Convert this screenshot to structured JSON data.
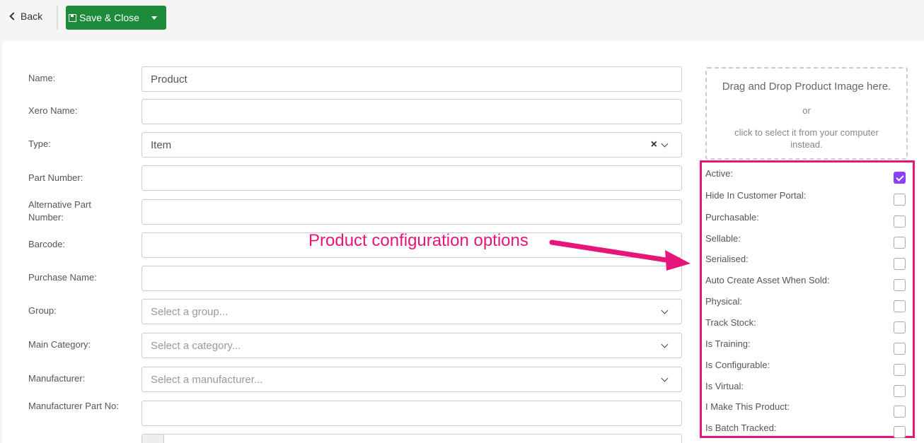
{
  "toolbar": {
    "back_label": "Back",
    "save_label": "Save & Close"
  },
  "form": {
    "name_label": "Name:",
    "name_value": "Product",
    "xero_label": "Xero Name:",
    "xero_value": "",
    "type_label": "Type:",
    "type_value": "Item",
    "part_label": "Part Number:",
    "part_value": "",
    "alt_part_label": "Alternative Part Number:",
    "alt_part_value": "",
    "barcode_label": "Barcode:",
    "barcode_value": "",
    "purchase_label": "Purchase Name:",
    "purchase_value": "",
    "group_label": "Group:",
    "group_placeholder": "Select a group...",
    "category_label": "Main Category:",
    "category_placeholder": "Select a category...",
    "manufacturer_label": "Manufacturer:",
    "manufacturer_placeholder": "Select a manufacturer...",
    "mpn_label": "Manufacturer Part No:",
    "mpn_value": ""
  },
  "image_drop": {
    "title": "Drag and Drop Product Image here.",
    "or": "or",
    "sub": "click to select it from your computer instead."
  },
  "options": [
    {
      "label": "Active:",
      "checked": true
    },
    {
      "label": "Hide In Customer Portal:",
      "checked": false
    },
    {
      "label": "Purchasable:",
      "checked": false
    },
    {
      "label": "Sellable:",
      "checked": false
    },
    {
      "label": "Serialised:",
      "checked": false
    },
    {
      "label": "Auto Create Asset When Sold:",
      "checked": false
    },
    {
      "label": "Physical:",
      "checked": false
    },
    {
      "label": "Track Stock:",
      "checked": false
    },
    {
      "label": "Is Training:",
      "checked": false
    },
    {
      "label": "Is Configurable:",
      "checked": false
    },
    {
      "label": "Is Virtual:",
      "checked": false
    },
    {
      "label": "I Make This Product:",
      "checked": false
    },
    {
      "label": "Is Batch Tracked:",
      "checked": false
    }
  ],
  "annotation": {
    "text": "Product configuration options",
    "color": "#e6157a"
  },
  "colors": {
    "save_button": "#1e8b3c",
    "checkbox_checked": "#8a3ffc"
  }
}
